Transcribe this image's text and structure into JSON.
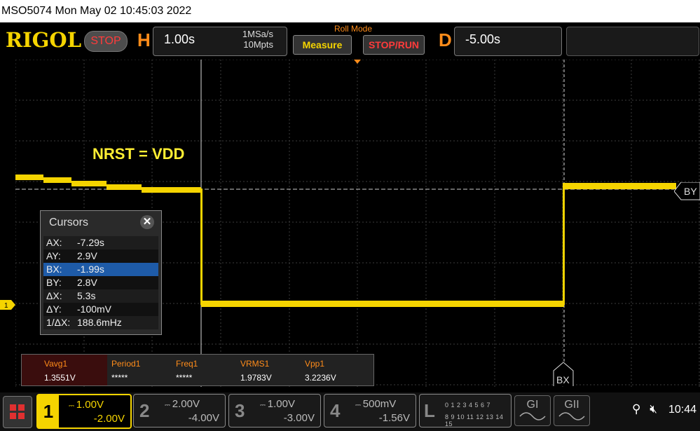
{
  "title_bar": {
    "text": "MSO5074  Mon May 02 10:45:03 2022"
  },
  "header": {
    "logo": "RIGOL",
    "run_state": "STOP",
    "horizontal": {
      "letter": "H",
      "scale": "1.00s",
      "sample_rate": "1MSa/s",
      "memory_depth": "10Mpts"
    },
    "roll_mode": "Roll Mode",
    "measure_label": "Measure",
    "stop_run_label": "STOP/RUN",
    "delay": {
      "letter": "D",
      "value": "-5.00s"
    }
  },
  "annotation": "NRST = VDD",
  "cursors": {
    "title": "Cursors",
    "close": "✕",
    "rows": [
      {
        "k": "AX:",
        "v": "-7.29s"
      },
      {
        "k": "AY:",
        "v": "2.9V"
      },
      {
        "k": "BX:",
        "v": "-1.99s"
      },
      {
        "k": "BY:",
        "v": "2.8V"
      },
      {
        "k": "ΔX:",
        "v": "5.3s"
      },
      {
        "k": "ΔY:",
        "v": "-100mV"
      },
      {
        "k": "1/ΔX:",
        "v": "188.6mHz"
      }
    ],
    "selected_index": 2
  },
  "markers": {
    "ch1": "1",
    "by": "BY",
    "bx": "BX"
  },
  "measurements": [
    {
      "name": "Vavg1",
      "value": "1.3551V"
    },
    {
      "name": "Period1",
      "value": "*****"
    },
    {
      "name": "Freq1",
      "value": "*****"
    },
    {
      "name": "VRMS1",
      "value": "1.9783V"
    },
    {
      "name": "Vpp1",
      "value": "3.2236V"
    }
  ],
  "channels": [
    {
      "num": "1",
      "scale": "1.00V",
      "offset": "-2.00V",
      "active": true
    },
    {
      "num": "2",
      "scale": "2.00V",
      "offset": "-4.00V",
      "active": false
    },
    {
      "num": "3",
      "scale": "1.00V",
      "offset": "-3.00V",
      "active": false
    },
    {
      "num": "4",
      "scale": "500mV",
      "offset": "-1.56V",
      "active": false
    }
  ],
  "logic": {
    "num": "L",
    "row1": "0 1 2 3  4 5 6 7",
    "row2": "8 9 10 11 12 13 14 15"
  },
  "generators": [
    "GI",
    "GII"
  ],
  "status": {
    "usb_icon": "usb-icon",
    "sound_icon": "speaker-muted-icon",
    "time": "10:44"
  },
  "colors": {
    "ch1": "#f5d400",
    "accent": "#ff8c1a",
    "stop": "#ff3b3b",
    "selection": "#1e5ba8"
  }
}
